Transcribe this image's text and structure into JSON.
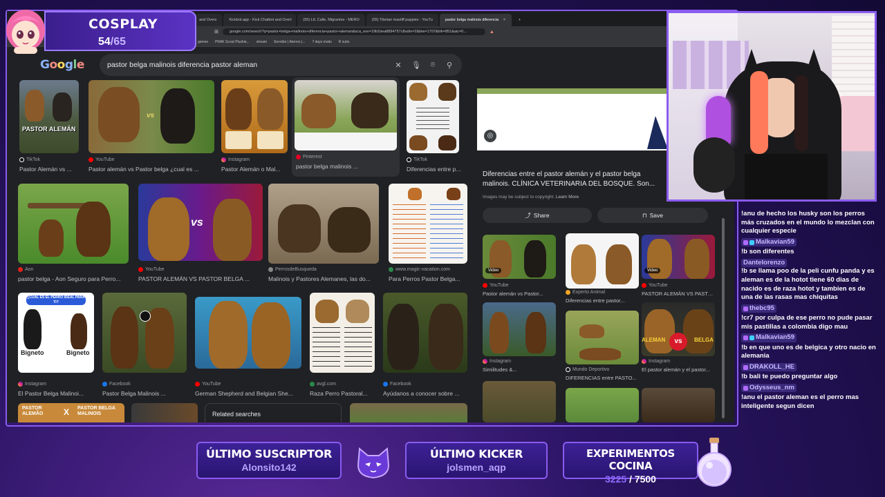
{
  "browser": {
    "tabs": [
      {
        "label": "and Overs"
      },
      {
        "label": "Kickbot.app - Kick Chatbot and Overl"
      },
      {
        "label": "(55) LIL Calle, Migrantes - MERO"
      },
      {
        "label": "(55) Tibetan mastiff puppies - YouTu"
      },
      {
        "label": "pastor belga malinois diferencia",
        "active": true
      }
    ],
    "url": "google.com/search?q=pastor+belga+malinois+diferencia+pastor+aleman&sca_esv=19b1bea8894757c8udm=2&biw=1707&bih=851&aic=0...",
    "bookmarks": [
      "gemes",
      "PRAK Scout Plushie...",
      "stream",
      "Servidor | Aterros |...",
      "7 days mods",
      "R subs"
    ]
  },
  "google": {
    "logo": "Google",
    "query": "pastor belga malinois diferencia pastor aleman"
  },
  "results": {
    "row1": [
      {
        "source": "TikTok",
        "title": "Pastor Alemán vs ..."
      },
      {
        "source": "YouTube",
        "title": "Pastor alemán vs Pastor belga ¿cual es ..."
      },
      {
        "source": "Instagram",
        "title": "Pastor Alemán o Mal..."
      },
      {
        "source": "Pinterest",
        "title": "pastor belga malinois ..."
      },
      {
        "source": "TikTok",
        "title": "Diferencias entre p..."
      }
    ],
    "row2": [
      {
        "source": "Aon",
        "title": "pastor belga - Aon Seguro para Perro..."
      },
      {
        "source": "YouTube",
        "title": "PASTOR ALEMÁN VS PASTOR BELGA ..."
      },
      {
        "source": "PerrosdeBusqueda",
        "title": "Malinois y Pastores Alemanes, las do..."
      },
      {
        "source": "www.magic-vacation.com",
        "title": "Para Perros Pastor Belga..."
      }
    ],
    "row3": [
      {
        "source": "Instagram",
        "title": "El Pastor Belga Malinoi..."
      },
      {
        "source": "Facebook",
        "title": "Pastor Belga Malinois ..."
      },
      {
        "source": "YouTube",
        "title": "German Shepherd and Belgian She..."
      },
      {
        "source": "avgl.com",
        "title": "Raza Perro Pastoral..."
      },
      {
        "source": "Facebook",
        "title": "Ayúdanos a conocer sobre ..."
      }
    ],
    "image_labels": {
      "pastor_aleman": "PASTOR ALEMÁN",
      "vs": "vs",
      "pastor_belga": "PASTOR BELGA MALINOIS",
      "bigneto": "Bigneto",
      "cual": "¿CUAL ES EL PERRO IDEAL PARA TI?",
      "bottom_left_a": "PASTOR ALEMÃO",
      "bottom_left_x": "X",
      "bottom_left_b": "PASTOR BELGA MALINOIS",
      "aleman": "ALEMAN",
      "belga": "BELGA"
    },
    "related": "Related searches"
  },
  "panel": {
    "title": "Diferencias entre el pastor alemán y el pastor belga malinois. CLÍNICA VETERINARIA DEL BOSQUE. Son...",
    "note": "Images may be subject to copyright.",
    "learn_more": "Learn More",
    "share": "Share",
    "save": "Save",
    "related": [
      {
        "source": "YouTube",
        "title": "Pastor alemán vs Pastor...",
        "badge": "Video"
      },
      {
        "source": "Experto Animal",
        "title": "Diferencias entre pastor..."
      },
      {
        "source": "YouTube",
        "title": "PASTOR ALEMÁN VS PASTO...",
        "badge": "Video"
      },
      {
        "source": "Instagram",
        "title": "Similitudes &..."
      },
      {
        "source": "Mundo Deportivo",
        "title": "DIFERENCIAS entre PASTO..."
      },
      {
        "source": "Instagram",
        "title": "El pastor alemán y el pastor..."
      }
    ]
  },
  "overlay": {
    "cosplay_title": "COSPLAY",
    "cosplay_count": "54",
    "cosplay_total": "/65",
    "sub_title": "ÚLTIMO SUSCRIPTOR",
    "sub_value": "Alonsito142",
    "kicker_title": "ÚLTIMO KICKER",
    "kicker_value": "jolsmen_aqp",
    "exp_title": "EXPERIMENTOS COCINA",
    "exp_current": "3225",
    "exp_total": "/ 7500"
  },
  "chat": [
    {
      "user": "",
      "text": "!anu de hecho los husky son los perros más cruzados en el mundo lo mezclan con cualquier especie"
    },
    {
      "user": "Malkavian59",
      "text": "!b son diferentes"
    },
    {
      "user": "Dantelorenzo",
      "text": "!b se llama poo de la peli cunfu panda y es aleman es de la hotot tiene 60 dias de nacido es de raza hotot y tambien es de una de las rasas mas chiquitas"
    },
    {
      "user": "thebc95",
      "text": "!cr7 por culpa de ese perro no pude pasar mis pastillas a colombia digo mau"
    },
    {
      "user": "Malkavian59",
      "text": "!b en que uno es de belgica y otro nacio en alemania"
    },
    {
      "user": "DRAKOLL_HE",
      "text": "!b bali te puedo preguntar algo"
    },
    {
      "user": "Odysseus_nm",
      "text": "!anu el pastor aleman es el perro mas inteligente segun dicen"
    }
  ],
  "colors": {
    "accent": "#8a5cf0",
    "google_bg": "#202124"
  }
}
